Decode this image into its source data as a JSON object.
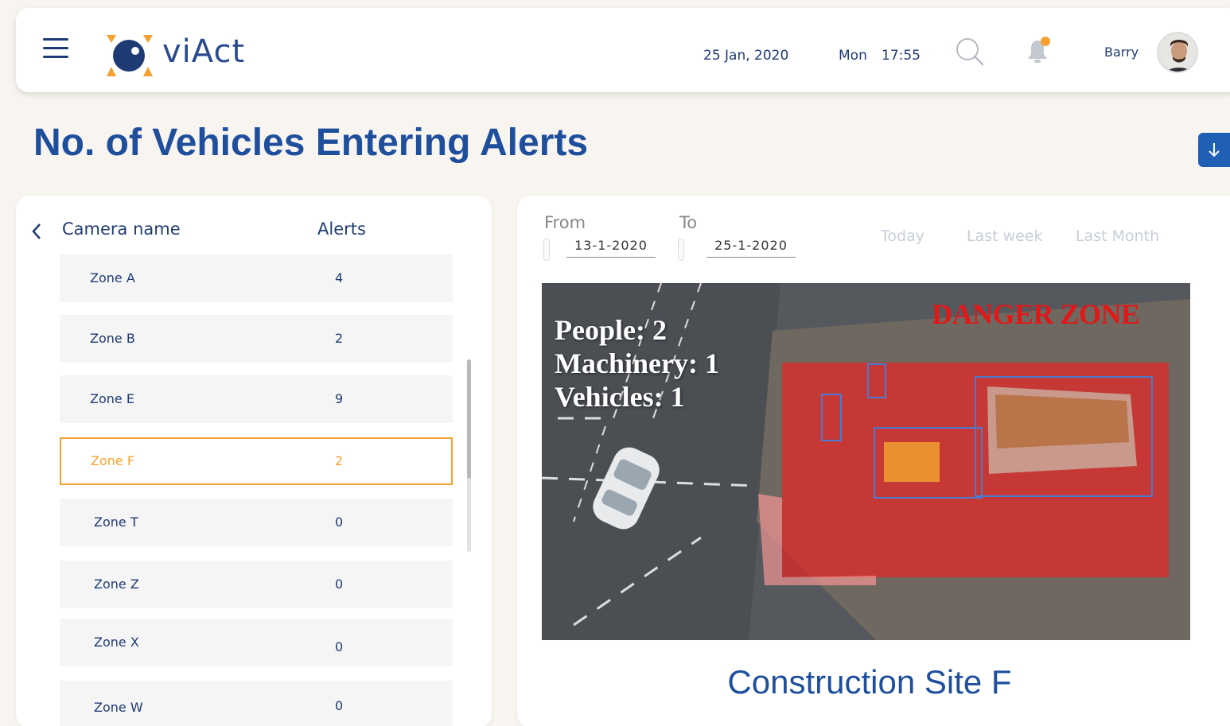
{
  "header": {
    "logo_text": "viAct",
    "date": "25 Jan, 2020",
    "day": "Mon",
    "time": "17:55",
    "user_name": "Barry",
    "notification_dot_color": "#f5a030"
  },
  "page": {
    "title": "No. of Vehicles Entering Alerts"
  },
  "camera_list": {
    "col_camera": "Camera name",
    "col_alerts": "Alerts",
    "rows": [
      {
        "name": "Zone A",
        "alerts": "4"
      },
      {
        "name": "Zone B",
        "alerts": "2"
      },
      {
        "name": "Zone E",
        "alerts": "9"
      },
      {
        "name": "Zone F",
        "alerts": "2"
      },
      {
        "name": "Zone T",
        "alerts": "0"
      },
      {
        "name": "Zone Z",
        "alerts": "0"
      },
      {
        "name": "Zone X",
        "alerts": "0"
      },
      {
        "name": "Zone W",
        "alerts": "0"
      }
    ],
    "selected": "Zone F"
  },
  "filters": {
    "from_label": "From",
    "to_label": "To",
    "from_value": "13-1-2020",
    "to_value": "25-1-2020",
    "quick_today": "Today",
    "quick_week": "Last week",
    "quick_month": "Last Month"
  },
  "camera_feed": {
    "people": "People: 2",
    "machinery": "Machinery: 1",
    "vehicles": "Vehicles: 1",
    "zone_label": "DANGER ZONE",
    "site_name": "Construction Site F"
  },
  "colors": {
    "accent": "#1f4f9c",
    "selected": "#f5a030",
    "danger": "#e01818"
  }
}
